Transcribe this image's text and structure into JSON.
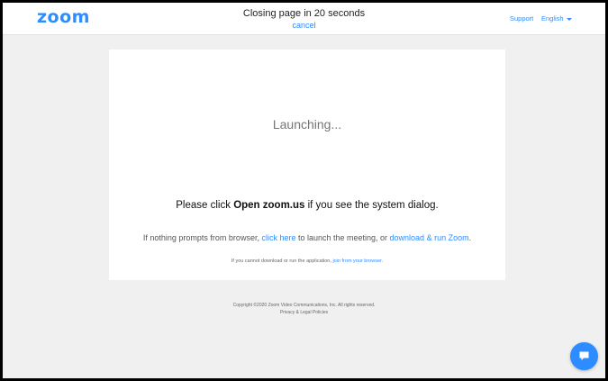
{
  "header": {
    "logo": "zoom",
    "countdown": "Closing page in 20 seconds",
    "cancel_label": "cancel",
    "support_label": "Support",
    "language_label": "English"
  },
  "card": {
    "launching": "Launching...",
    "open_prefix": "Please click ",
    "open_bold": "Open zoom.us",
    "open_suffix": " if you see the system dialog.",
    "nothing_prefix": "If nothing prompts from browser, ",
    "click_here": "click here",
    "nothing_middle": " to launch the meeting, or ",
    "download_run": "download & run Zoom",
    "nothing_suffix": ".",
    "cannot_prefix": "If you cannot download or run the application, ",
    "join_browser": "join from your browser",
    "cannot_suffix": "."
  },
  "footer": {
    "copyright": "Copyright ©2020 Zoom Video Communications, Inc. All rights reserved.",
    "policies": "Privacy & Legal Policies"
  },
  "chat": {
    "icon": "chat-bubble-icon"
  },
  "colors": {
    "brand_blue": "#2d8cff",
    "page_background": "#f0f0f0",
    "card_background": "#ffffff"
  }
}
